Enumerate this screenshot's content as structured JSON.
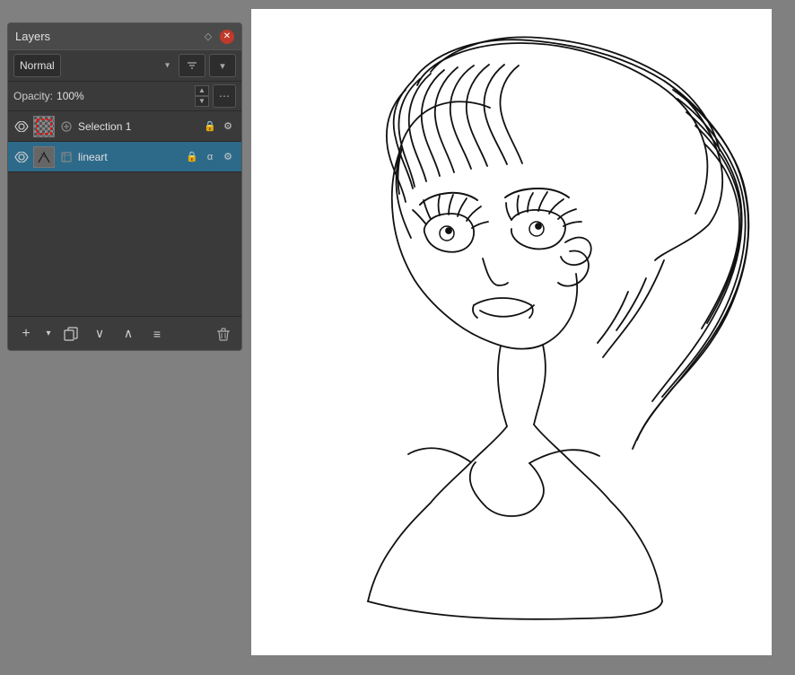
{
  "panel": {
    "title": "Layers",
    "blend_mode": "Normal",
    "opacity_label": "Opacity:",
    "opacity_value": "100%"
  },
  "layers": [
    {
      "id": "selection1",
      "name": "Selection 1",
      "visible": true,
      "active": false,
      "type": "selection"
    },
    {
      "id": "lineart",
      "name": "lineart",
      "visible": true,
      "active": true,
      "type": "paint"
    }
  ],
  "toolbar": {
    "add_label": "+",
    "duplicate_label": "⧉",
    "move_down_label": "∨",
    "move_up_label": "∧",
    "properties_label": "≡",
    "delete_label": "🗑"
  }
}
